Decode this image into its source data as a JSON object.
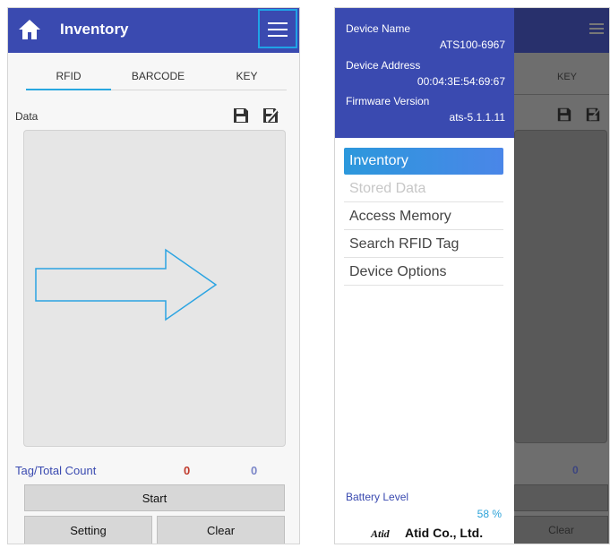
{
  "left_screen": {
    "title": "Inventory",
    "tabs": [
      {
        "label": "RFID",
        "active": true
      },
      {
        "label": "BARCODE",
        "active": false
      },
      {
        "label": "KEY",
        "active": false
      }
    ],
    "data_label": "Data",
    "count_label": "Tag/Total Count",
    "tag_count": "0",
    "total_count": "0",
    "buttons": {
      "start": "Start",
      "setting": "Setting",
      "clear": "Clear"
    }
  },
  "right_screen": {
    "drawer": {
      "device_name_label": "Device Name",
      "device_name": "ATS100-6967",
      "device_address_label": "Device Address",
      "device_address": "00:04:3E:54:69:67",
      "firmware_label": "Firmware Version",
      "firmware_version": "ats-5.1.1.11",
      "menu": [
        {
          "label": "Inventory",
          "state": "active"
        },
        {
          "label": "Stored Data",
          "state": "disabled"
        },
        {
          "label": "Access Memory",
          "state": "normal"
        },
        {
          "label": "Search RFID Tag",
          "state": "normal"
        },
        {
          "label": "Device Options",
          "state": "normal"
        }
      ],
      "battery_label": "Battery Level",
      "battery_value": "58 %",
      "company_logo": "Atid",
      "company_name": "Atid Co., Ltd."
    },
    "background": {
      "tab_label": "KEY",
      "total_count": "0",
      "clear_label": "Clear"
    }
  },
  "colors": {
    "app_bar": "#3a4ab0",
    "highlight": "#1fa3e6",
    "tab_indicator": "#29a8e0",
    "tag_count": "#c0392b",
    "total_count": "#7b86c8",
    "menu_active": "#2c98dc"
  }
}
